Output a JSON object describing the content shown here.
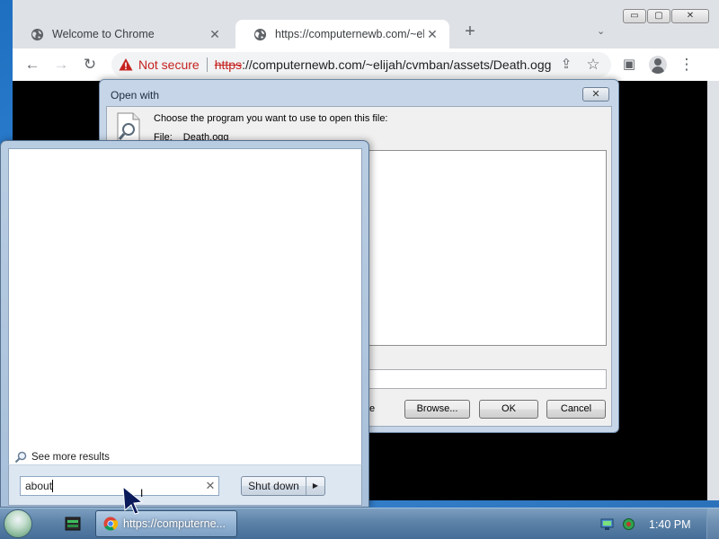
{
  "browser": {
    "tabs": [
      {
        "title": "Welcome to Chrome",
        "close": "✕"
      },
      {
        "title": "https://computernewb.com/~elijah",
        "close": "✕"
      }
    ],
    "new_tab": "+",
    "tab_search": "⌄",
    "window_controls": {
      "minimize": "▭",
      "maximize": "▢",
      "close": "✕"
    },
    "toolbar": {
      "back": "←",
      "forward": "→",
      "reload": "↻",
      "share": "⇪",
      "bookmark": "☆",
      "side_panel": "▣",
      "menu": "⋮"
    },
    "omnibox": {
      "security_label": "Not secure",
      "url_scheme": "https",
      "url_rest": "://computernewb.com/~elijah/cvmban/assets/Death.ogg"
    }
  },
  "open_with_dialog": {
    "title": "Open with",
    "close": "✕",
    "prompt": "Choose the program you want to use to open this file:",
    "file_label": "File:",
    "file_name": "Death.ogg",
    "hint_tail": "e",
    "buttons": {
      "browse": "Browse...",
      "ok": "OK",
      "cancel": "Cancel"
    }
  },
  "start_menu": {
    "see_more": "See more results",
    "search": {
      "value": "about",
      "clear": "✕"
    },
    "shutdown": {
      "label": "Shut down",
      "arrow": "▶"
    }
  },
  "taskbar": {
    "chrome_button": "https://computerne...",
    "clock": "1:40 PM",
    "ibeam": "I"
  },
  "colors": {
    "not_secure": "#c5221f",
    "taskbar": "#456d97",
    "desktop": "#2f7ad0"
  }
}
